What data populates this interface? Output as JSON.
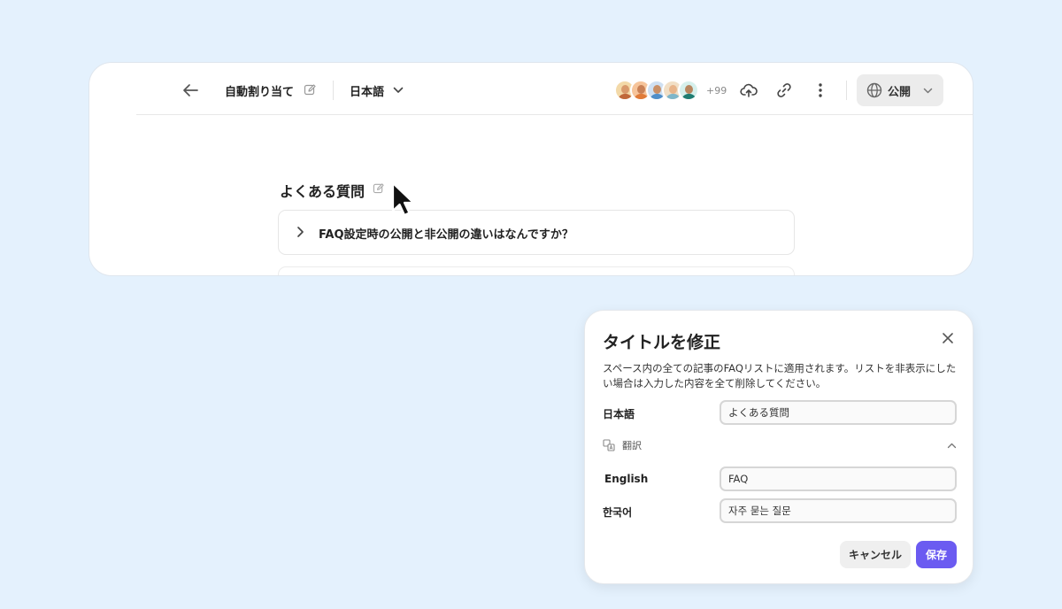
{
  "colors": {
    "background": "#e4f1fd",
    "accent": "#6b5bf1",
    "card": "#ffffff"
  },
  "toolbar": {
    "back_icon": "arrow-left-icon",
    "doc_title": "自動割り当て",
    "language": "日本語",
    "avatar_more": "+99",
    "icons": [
      "cloud-upload-icon",
      "link-icon",
      "more-vertical-icon"
    ],
    "publish_icon": "globe-icon",
    "publish_label": "公開"
  },
  "content": {
    "faq_heading": "よくある質問",
    "faq_items": [
      {
        "question": "FAQ設定時の公開と非公開の違いはなんですか？"
      }
    ]
  },
  "dialog": {
    "title": "タイトルを修正",
    "description": "スペース内の全ての記事のFAQリストに適用されます。リストを非表示にしたい場合は入力した内容を全て削除してください。",
    "fields": [
      {
        "label": "日本語",
        "value": "よくある質問"
      },
      {
        "label": "English",
        "value": "FAQ"
      },
      {
        "label": "한국어",
        "value": "자주 묻는 질문"
      }
    ],
    "translation_label": "翻訳",
    "translation_icon": "translate-icon",
    "cancel_label": "キャンセル",
    "save_label": "保存"
  }
}
